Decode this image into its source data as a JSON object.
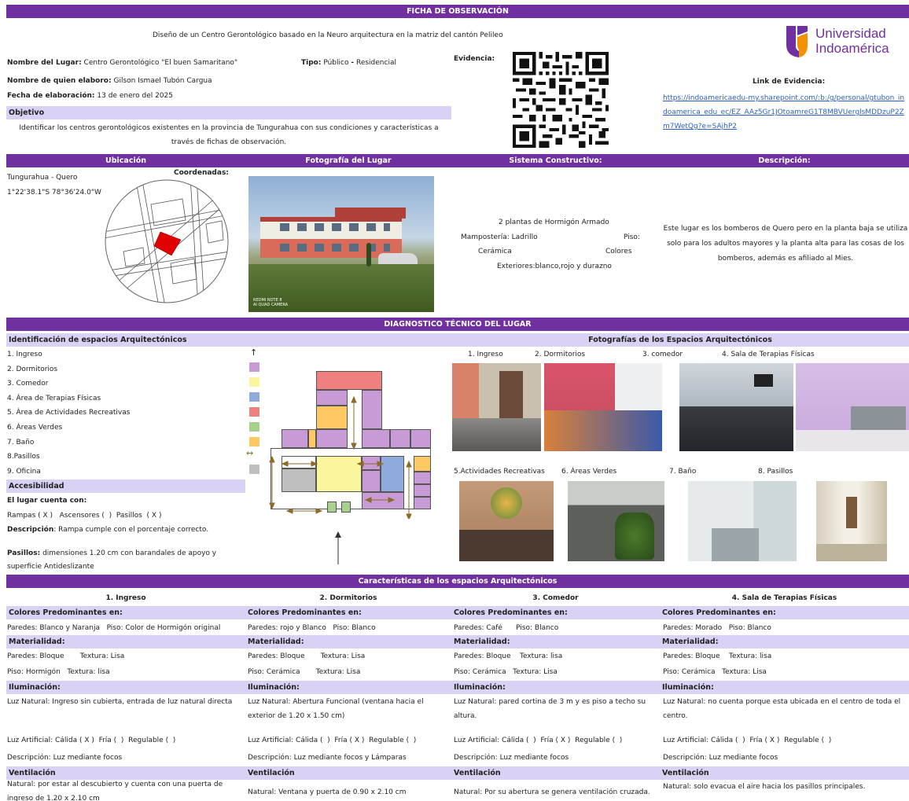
{
  "header": {
    "title": "FICHA DE OBSERVACIÓN",
    "subtitle": "Diseño de un Centro Gerontológico basado en la Neuro arquitectura en la matriz del cantón Pelileo",
    "logo_text_1": "Universidad",
    "logo_text_2": "Indoamérica"
  },
  "info": {
    "nombre_label": "Nombre del Lugar:",
    "nombre_value": "Centro Gerontológico \"El buen Samaritano\"",
    "tipo_label": "Tipo:",
    "tipo_value_1": "Público",
    "tipo_dash": "-",
    "tipo_value_2": "Residencial",
    "elaboro_label": "Nombre de quien elaboro:",
    "elaboro_value": "Gilson Ismael Tubón Cargua",
    "fecha_label": "Fecha de elaboración:",
    "fecha_value": "13 de enero del 2025",
    "objetivo_label": "Objetivo",
    "objetivo_text": "Identificar los centros gerontológicos existentes en la provincia de Tungurahua con sus condiciones y características a través de fichas de observación.",
    "evidencia_label": "Evidencia:",
    "link_label": "Link de Evidencia:",
    "link_url": "https://indoamericaedu-my.sharepoint.com/:b:/g/personal/gtubon_indoamerica_edu_ec/EZ_AAz5Gr1JOtoamreG1T8MBVUerglsMDDzuP2Zm7WetQg?e=SAjhP2"
  },
  "section1": {
    "ubicacion": "Ubicación",
    "fotografia": "Fotografía del Lugar",
    "sistema": "Sistema Constructivo:",
    "descripcion": "Descripción:",
    "place": "Tungurahua - Quero",
    "coords_label": "Coordenadas:",
    "coords": "1°22'38.1\"S 78°36'24.0\"W",
    "sistema_text_1": "2 plantas de Hormigón Armado",
    "sistema_text_2a": "Mampostería: Ladrillo",
    "sistema_text_2b": "Piso:",
    "sistema_text_3a": "Cerámica",
    "sistema_text_3b": "Colores",
    "sistema_text_4": "Exteriores:blanco,rojo y durazno",
    "descripcion_text": "Este lugar es los bomberos de Quero pero en la planta baja se utiliza solo para los adultos mayores y la planta alta para las cosas de los bomberos, además es afiliado al Mies.",
    "photo_stamp_1": "REDMI NOTE 8",
    "photo_stamp_2": "AI QUAD CAMERA"
  },
  "diagnostico": {
    "title": "DIAGNOSTICO TÉCNICO DEL LUGAR",
    "ident_label": "Identificación de espacios Arquitectónicos",
    "fotos_label": "Fotografías de los Espacios Arquitectónicos",
    "spaces": [
      {
        "label": "1. Ingreso",
        "color": ""
      },
      {
        "label": "2. Dormitorios",
        "color": "#c89ad6"
      },
      {
        "label": "3. Comedor",
        "color": "#fbf59d"
      },
      {
        "label": "4. Área de Terapias Físicas",
        "color": "#8faadc"
      },
      {
        "label": "5. Área de Actividades Recreativas",
        "color": "#f08080"
      },
      {
        "label": "6. Áreas Verdes",
        "color": "#a9d18e"
      },
      {
        "label": "7. Baño",
        "color": "#ffc863"
      },
      {
        "label": "8.Pasillos",
        "color": ""
      },
      {
        "label": "9. Oficina",
        "color": "#bfbfbf"
      }
    ],
    "accesibilidad_label": "Accesibilidad",
    "cuenta_label": "El lugar cuenta con:",
    "cuenta_items": "Rampas ( X )   Ascensores (  )  Pasillos  ( X )",
    "desc_label": "Descripción",
    "desc_text": ": Rampa cumple con el porcentaje correcto.",
    "pasillos_label": "Pasillos:",
    "pasillos_text": "dimensiones 1.20 cm con barandales de apoyo y superficie Antideslizante",
    "photo_labels_top": [
      "1. Ingreso",
      "2. Dormitorios",
      "3. comedor",
      "4. Sala de Terapias Físicas"
    ],
    "photo_labels_bottom": [
      "5.Actividades Recreativas",
      "6. Áreas Verdes",
      "7. Baño",
      "8. Pasillos"
    ]
  },
  "caracteristicas": {
    "title": "Características de los espacios Arquitectónicos",
    "colores_label": "Colores Predominantes en:",
    "materialidad_label": "Materialidad:",
    "iluminacion_label": "Iluminación:",
    "ventilacion_label": "Ventilación",
    "columns": [
      {
        "title": "1. Ingreso",
        "colores": "Paredes: Blanco y Naranja   Piso: Color de Hormigón original",
        "mat1": "Paredes: Bloque       Textura: Lisa",
        "mat2": "Piso: Hormigón   Textura: lisa",
        "luz_natural": "Luz Natural: Ingreso sin cubierta, entrada de luz natural directa",
        "luz_artificial": "Luz Artificial: Cálida ( X )  Fría (  )  Regulable (  )",
        "desc": "Descripción: Luz mediante focos",
        "vent": "Natural: por estar al descubierto y cuenta con una puerta de ingreso de 1.20 x 2.10 cm"
      },
      {
        "title": "2. Dormitorios",
        "colores": "Paredes: rojo y Blanco   Piso: Blanco",
        "mat1": "Paredes: Bloque       Textura: Lisa",
        "mat2": "Piso: Cerámica       Textura: Lisa",
        "luz_natural": "Luz Natural: Abertura Funcional (ventana hacia el exterior de 1.20 x 1.50 cm)",
        "luz_artificial": "Luz Artificial: Cálida (  )  Fría ( X )  Regulable (  )",
        "desc": "Descripción: Luz mediante focos y Lámparas",
        "vent": "Natural: Ventana y puerta de 0.90 x 2.10 cm"
      },
      {
        "title": "3. Comedor",
        "colores": "Paredes: Café      Piso: Blanco",
        "mat1": "Paredes: Bloque    Textura: lisa",
        "mat2": "Piso: Cerámica   Textura: Lisa",
        "luz_natural": "Luz Natural: pared cortina de 3 m y es piso a techo su altura.",
        "luz_artificial": "Luz Artificial: Cálida (  )  Fría ( X )  Regulable (  )",
        "desc": "Descripción: Luz mediante focos",
        "vent": "Natural: Por su abertura se genera ventilación cruzada."
      },
      {
        "title": "4. Sala de Terapias Físicas",
        "colores": "Paredes: Morado   Piso: Blanco",
        "mat1": "Paredes: Bloque    Textura: lisa",
        "mat2": "Piso: Cerámica   Textura: Lisa",
        "luz_natural": "Luz Natural: no cuenta porque esta ubicada en el centro de toda el centro.",
        "luz_artificial": "Luz Artificial: Cálida (  )  Fría ( X )  Regulable (  )",
        "desc": "Descripción: Luz mediante focos",
        "vent": "Natural: solo evacua el aire hacia los pasillos principales."
      }
    ]
  }
}
